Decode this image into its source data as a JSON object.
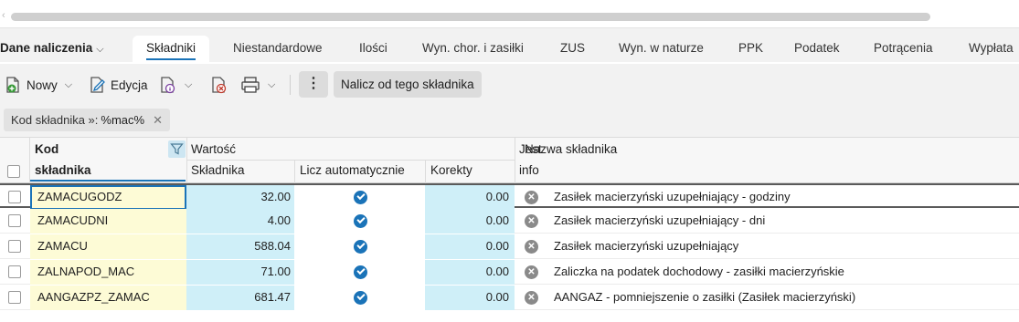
{
  "tabs": {
    "dropdown_label": "Dane naliczenia",
    "items": [
      {
        "label": "Składniki",
        "active": true
      },
      {
        "label": "Niestandardowe"
      },
      {
        "label": "Ilości"
      },
      {
        "label": "Wyn. chor. i zasiłki"
      },
      {
        "label": "ZUS"
      },
      {
        "label": "Wyn. w naturze"
      },
      {
        "label": "PPK"
      },
      {
        "label": "Podatek"
      },
      {
        "label": "Potrącenia"
      },
      {
        "label": "Wypłata"
      }
    ]
  },
  "toolbar": {
    "new_label": "Nowy",
    "edit_label": "Edycja",
    "calc_label": "Nalicz od tego składnika",
    "more_label": "⋮"
  },
  "filter_chip": {
    "label": "Kod składnika »:",
    "value": "%mac%",
    "close": "✕"
  },
  "grid": {
    "headers": {
      "kod_top": "Kod",
      "kod_bottom": "składnika",
      "wartosc": "Wartość",
      "skladnika": "Składnika",
      "licz_auto": "Licz automatycznie",
      "korekty": "Korekty",
      "jest_top": "Jest",
      "jest_bottom": "info",
      "nazwa": "Nazwa składnika"
    },
    "rows": [
      {
        "code": "ZAMACUGODZ",
        "value": "32.00",
        "auto": true,
        "correction": "0.00",
        "info": false,
        "name": "Zasiłek macierzyński uzupełniający - godziny",
        "selected": true
      },
      {
        "code": "ZAMACUDNI",
        "value": "4.00",
        "auto": true,
        "correction": "0.00",
        "info": false,
        "name": "Zasiłek macierzyński uzupełniający - dni"
      },
      {
        "code": "ZAMACU",
        "value": "588.04",
        "auto": true,
        "correction": "0.00",
        "info": false,
        "name": "Zasiłek macierzyński uzupełniający"
      },
      {
        "code": "ZALNAPOD_MAC",
        "value": "71.00",
        "auto": true,
        "correction": "0.00",
        "info": false,
        "name": "Zaliczka na podatek dochodowy - zasiłki macierzyńskie"
      },
      {
        "code": "AANGAZPZ_ZAMAC",
        "value": "681.47",
        "auto": true,
        "correction": "0.00",
        "info": false,
        "name": "AANGAZ - pomniejszenie o zasiłki (Zasiłek macierzyński)"
      }
    ]
  },
  "colors": {
    "accent": "#1a73b8",
    "code_cell_bg": "#fdfbd6",
    "value_cell_bg": "#cfeff8"
  }
}
